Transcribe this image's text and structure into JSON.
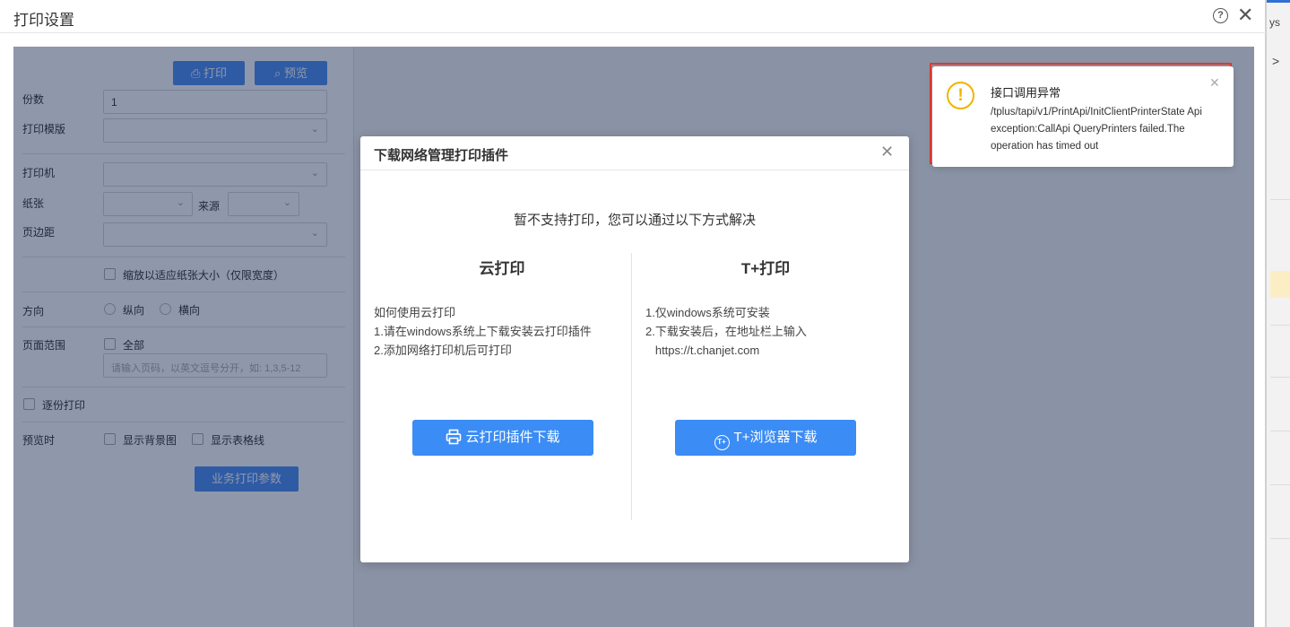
{
  "window": {
    "title": "打印设置",
    "help_glyph": "?",
    "close_glyph": "✕"
  },
  "background_app": {
    "fragment_ys": "ys",
    "fragment_chevron": ">"
  },
  "left_panel": {
    "print_button": "打印",
    "preview_button": "预览",
    "copies_label": "份数",
    "copies_value": "1",
    "template_label": "打印模版",
    "printer_label": "打印机",
    "paper_label": "纸张",
    "source_label": "来源",
    "margin_label": "页边距",
    "fit_paper_label": "缩放以适应纸张大小（仅限宽度）",
    "orientation_label": "方向",
    "portrait_label": "纵向",
    "landscape_label": "横向",
    "page_range_label": "页面范围",
    "all_pages_label": "全部",
    "page_range_placeholder": "请输入页码，以英文逗号分开，如: 1,3,5-12",
    "collate_label": "逐份打印",
    "preview_options_label": "预览时",
    "show_bg_label": "显示背景图",
    "show_grid_label": "显示表格线",
    "business_params_button": "业务打印参数"
  },
  "modal": {
    "title": "下载网络管理打印插件",
    "subtitle": "暂不支持打印，您可以通过以下方式解决",
    "cloud": {
      "title": "云打印",
      "lines": [
        "如何使用云打印",
        "1.请在windows系统上下载安装云打印插件",
        "2.添加网络打印机后可打印"
      ],
      "button": "云打印插件下载"
    },
    "tplus": {
      "title": "T+打印",
      "lines": [
        "1.仅windows系统可安装",
        "2.下载安装后，在地址栏上输入",
        "   https://t.chanjet.com"
      ],
      "icon_text": "T+",
      "button": "T+浏览器下载"
    }
  },
  "toast": {
    "title": "接口调用异常",
    "message": "/tplus/tapi/v1/PrintApi/InitClientPrinterState Api exception:CallApi QueryPrinters failed.The operation has timed out",
    "icon_glyph": "!"
  },
  "colors": {
    "primary": "#3b8cf5",
    "warning": "#f0b400",
    "highlight_border": "#e23a2d"
  }
}
